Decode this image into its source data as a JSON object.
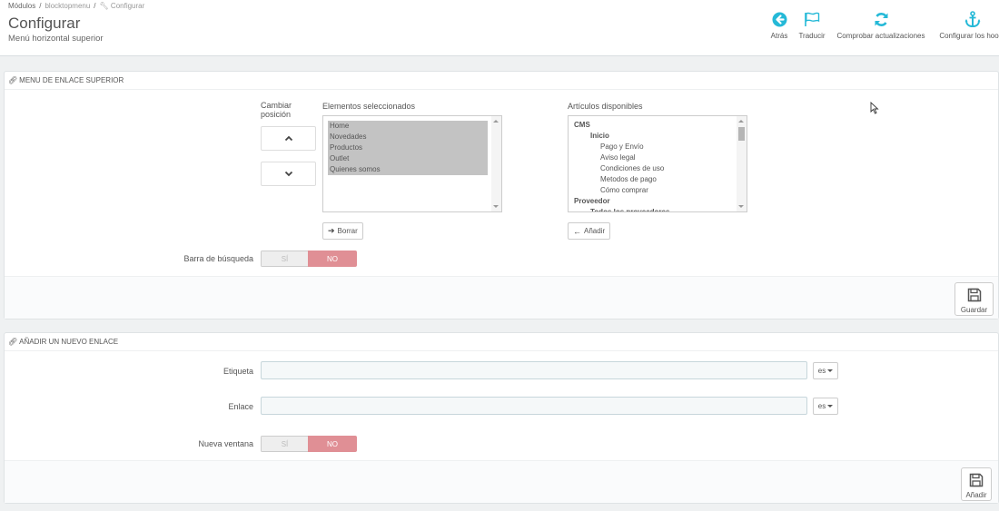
{
  "breadcrumb": {
    "modules": "Módulos",
    "module": "blocktopmenu",
    "current": "Configurar"
  },
  "header": {
    "title": "Configurar",
    "subtitle": "Menú horizontal superior"
  },
  "toolbar": {
    "back": {
      "label": "Atrás",
      "icon": "arrow-circle-left-icon"
    },
    "translate": {
      "label": "Traducir",
      "icon": "flag-icon"
    },
    "updates": {
      "label": "Comprobar actualizaciones",
      "icon": "refresh-icon"
    },
    "hooks": {
      "label": "Configurar los hooks",
      "icon": "anchor-icon"
    }
  },
  "menu_panel": {
    "heading": "MENU DE ENLACE SUPERIOR",
    "change_position_label": "Cambiar posición",
    "selected_title": "Elementos seleccionados",
    "selected_items": [
      "Home",
      "Novedades",
      "Productos",
      "Outlet",
      "Quienes somos"
    ],
    "available_title": "Artículos disponibles",
    "available_items": [
      {
        "text": "CMS",
        "level": 0
      },
      {
        "text": "Inicio",
        "level": 1
      },
      {
        "text": "Pago y Envío",
        "level": 2
      },
      {
        "text": "Aviso legal",
        "level": 2
      },
      {
        "text": "Condiciones de uso",
        "level": 2
      },
      {
        "text": "Metodos de pago",
        "level": 2
      },
      {
        "text": "Cómo comprar",
        "level": 2
      },
      {
        "text": "Proveedor",
        "level": 0
      },
      {
        "text": "Todos los proveedores",
        "level": 1
      }
    ],
    "remove_label": "Borrar",
    "add_label": "Añadir",
    "search_bar_label": "Barra de búsqueda",
    "switch_yes": "SÍ",
    "switch_no": "NO",
    "save_label": "Guardar"
  },
  "new_link_panel": {
    "heading": "AÑADIR UN NUEVO ENLACE",
    "label_field": "Etiqueta",
    "link_field": "Enlace",
    "lang": "es",
    "new_window_label": "Nueva ventana",
    "switch_yes": "SÍ",
    "switch_no": "NO",
    "add_label": "Añadir"
  },
  "colors": {
    "accent": "#25b9d7",
    "switch_no": "#e08f95",
    "page_bg": "#eff1f2"
  }
}
